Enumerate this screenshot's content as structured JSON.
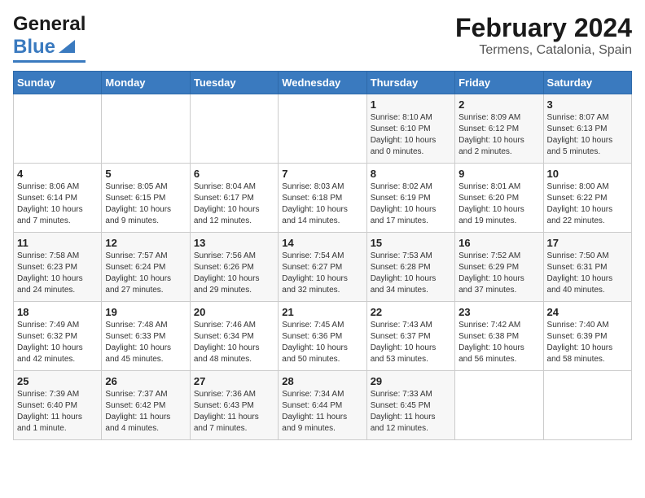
{
  "header": {
    "logo_general": "General",
    "logo_blue": "Blue",
    "title": "February 2024",
    "subtitle": "Termens, Catalonia, Spain"
  },
  "weekdays": [
    "Sunday",
    "Monday",
    "Tuesday",
    "Wednesday",
    "Thursday",
    "Friday",
    "Saturday"
  ],
  "weeks": [
    [
      {
        "day": "",
        "content": ""
      },
      {
        "day": "",
        "content": ""
      },
      {
        "day": "",
        "content": ""
      },
      {
        "day": "",
        "content": ""
      },
      {
        "day": "1",
        "content": "Sunrise: 8:10 AM\nSunset: 6:10 PM\nDaylight: 10 hours\nand 0 minutes."
      },
      {
        "day": "2",
        "content": "Sunrise: 8:09 AM\nSunset: 6:12 PM\nDaylight: 10 hours\nand 2 minutes."
      },
      {
        "day": "3",
        "content": "Sunrise: 8:07 AM\nSunset: 6:13 PM\nDaylight: 10 hours\nand 5 minutes."
      }
    ],
    [
      {
        "day": "4",
        "content": "Sunrise: 8:06 AM\nSunset: 6:14 PM\nDaylight: 10 hours\nand 7 minutes."
      },
      {
        "day": "5",
        "content": "Sunrise: 8:05 AM\nSunset: 6:15 PM\nDaylight: 10 hours\nand 9 minutes."
      },
      {
        "day": "6",
        "content": "Sunrise: 8:04 AM\nSunset: 6:17 PM\nDaylight: 10 hours\nand 12 minutes."
      },
      {
        "day": "7",
        "content": "Sunrise: 8:03 AM\nSunset: 6:18 PM\nDaylight: 10 hours\nand 14 minutes."
      },
      {
        "day": "8",
        "content": "Sunrise: 8:02 AM\nSunset: 6:19 PM\nDaylight: 10 hours\nand 17 minutes."
      },
      {
        "day": "9",
        "content": "Sunrise: 8:01 AM\nSunset: 6:20 PM\nDaylight: 10 hours\nand 19 minutes."
      },
      {
        "day": "10",
        "content": "Sunrise: 8:00 AM\nSunset: 6:22 PM\nDaylight: 10 hours\nand 22 minutes."
      }
    ],
    [
      {
        "day": "11",
        "content": "Sunrise: 7:58 AM\nSunset: 6:23 PM\nDaylight: 10 hours\nand 24 minutes."
      },
      {
        "day": "12",
        "content": "Sunrise: 7:57 AM\nSunset: 6:24 PM\nDaylight: 10 hours\nand 27 minutes."
      },
      {
        "day": "13",
        "content": "Sunrise: 7:56 AM\nSunset: 6:26 PM\nDaylight: 10 hours\nand 29 minutes."
      },
      {
        "day": "14",
        "content": "Sunrise: 7:54 AM\nSunset: 6:27 PM\nDaylight: 10 hours\nand 32 minutes."
      },
      {
        "day": "15",
        "content": "Sunrise: 7:53 AM\nSunset: 6:28 PM\nDaylight: 10 hours\nand 34 minutes."
      },
      {
        "day": "16",
        "content": "Sunrise: 7:52 AM\nSunset: 6:29 PM\nDaylight: 10 hours\nand 37 minutes."
      },
      {
        "day": "17",
        "content": "Sunrise: 7:50 AM\nSunset: 6:31 PM\nDaylight: 10 hours\nand 40 minutes."
      }
    ],
    [
      {
        "day": "18",
        "content": "Sunrise: 7:49 AM\nSunset: 6:32 PM\nDaylight: 10 hours\nand 42 minutes."
      },
      {
        "day": "19",
        "content": "Sunrise: 7:48 AM\nSunset: 6:33 PM\nDaylight: 10 hours\nand 45 minutes."
      },
      {
        "day": "20",
        "content": "Sunrise: 7:46 AM\nSunset: 6:34 PM\nDaylight: 10 hours\nand 48 minutes."
      },
      {
        "day": "21",
        "content": "Sunrise: 7:45 AM\nSunset: 6:36 PM\nDaylight: 10 hours\nand 50 minutes."
      },
      {
        "day": "22",
        "content": "Sunrise: 7:43 AM\nSunset: 6:37 PM\nDaylight: 10 hours\nand 53 minutes."
      },
      {
        "day": "23",
        "content": "Sunrise: 7:42 AM\nSunset: 6:38 PM\nDaylight: 10 hours\nand 56 minutes."
      },
      {
        "day": "24",
        "content": "Sunrise: 7:40 AM\nSunset: 6:39 PM\nDaylight: 10 hours\nand 58 minutes."
      }
    ],
    [
      {
        "day": "25",
        "content": "Sunrise: 7:39 AM\nSunset: 6:40 PM\nDaylight: 11 hours\nand 1 minute."
      },
      {
        "day": "26",
        "content": "Sunrise: 7:37 AM\nSunset: 6:42 PM\nDaylight: 11 hours\nand 4 minutes."
      },
      {
        "day": "27",
        "content": "Sunrise: 7:36 AM\nSunset: 6:43 PM\nDaylight: 11 hours\nand 7 minutes."
      },
      {
        "day": "28",
        "content": "Sunrise: 7:34 AM\nSunset: 6:44 PM\nDaylight: 11 hours\nand 9 minutes."
      },
      {
        "day": "29",
        "content": "Sunrise: 7:33 AM\nSunset: 6:45 PM\nDaylight: 11 hours\nand 12 minutes."
      },
      {
        "day": "",
        "content": ""
      },
      {
        "day": "",
        "content": ""
      }
    ]
  ]
}
